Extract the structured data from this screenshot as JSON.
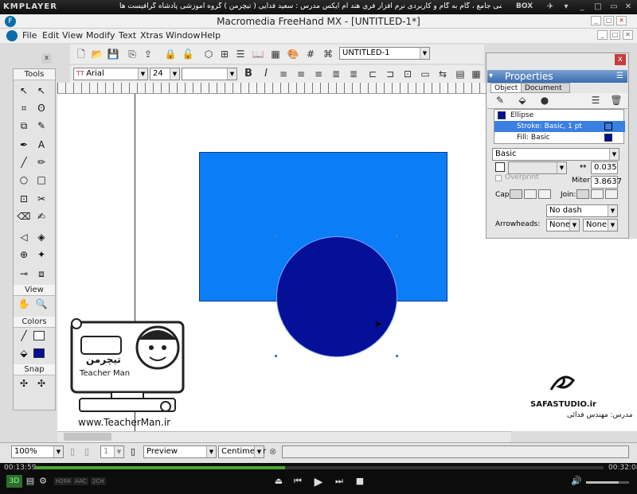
{
  "kmp": {
    "logo": "KMPLAYER",
    "title": "مجموعه آموزشی جامع ، گام به گام و کاربردی نرم افزار فری هند ام ایکس   مدرس : سعید فدایی ( تیچرمن ) گروه آموزشی پادشاه گرافیست ها",
    "box": "BOX",
    "time_elapsed": "00:13:59",
    "time_total": "00:32:08",
    "progress": 0.44,
    "volume": 0.75,
    "codec_labels": [
      "H264",
      "AAC",
      "2CH"
    ]
  },
  "app": {
    "title": "Macromedia FreeHand MX - [UNTITLED-1*]",
    "menu": [
      "File",
      "Edit",
      "View",
      "Modify",
      "Text",
      "Xtras",
      "Window",
      "Help"
    ],
    "document_selector": "UNTITLED-1",
    "font_name": "Arial",
    "font_size": "24"
  },
  "tools": {
    "title": "Tools",
    "view_label": "View",
    "colors_label": "Colors",
    "snap_label": "Snap"
  },
  "properties": {
    "title": "Properties",
    "tabs": [
      "Object",
      "Document"
    ],
    "list": [
      "Ellipse",
      "Stroke: Basic, 1 pt",
      "Fill: Basic"
    ],
    "stroke_type": "Basic",
    "overprint": "Overprint",
    "stroke_width": "0.035",
    "miter_label": "Miter:",
    "miter_value": "3.8637",
    "cap_label": "Cap:",
    "join_label": "Join:",
    "dash": "No dash",
    "arrowheads_label": "Arrowheads:",
    "arrow_start": "None",
    "arrow_end": "None"
  },
  "status": {
    "zoom": "100%",
    "page": "1",
    "mode": "Preview",
    "units": "Centimeter"
  },
  "logo": {
    "brand_fa": "تیچرمن",
    "brand_en": "Teacher Man",
    "url": "www.TeacherMan.ir"
  },
  "safa": {
    "name": "SAFASTUDIO.ir",
    "teacher": "مدرس: مهندس فدائی"
  },
  "colors": {
    "rect": "#0a7df7",
    "circle": "#050f97",
    "selection": "#3b7fe0"
  }
}
